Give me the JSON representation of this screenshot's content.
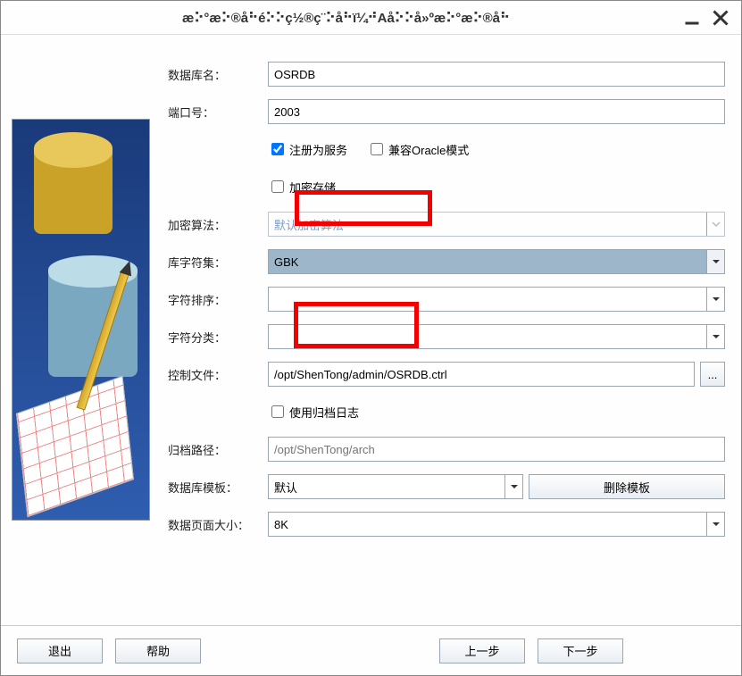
{
  "titlebar": {
    "title": "æ⠕°æ⠕®å⠓é⠕⠕ç½®ç¨⠕å⠓ï¼⠚Aå⠕⠕å»ºæ⠕°æ⠕®å⠓"
  },
  "labels": {
    "db_name": "数据库名：",
    "port": "端口号：",
    "reg_service": "注册为服务",
    "oracle_mode": "兼容Oracle模式",
    "encrypt_store": "加密存储",
    "encrypt_algo": "加密算法：",
    "charset": "库字符集：",
    "collation": "字符排序：",
    "char_class": "字符分类：",
    "ctrl_file": "控制文件：",
    "use_archive": "使用归档日志",
    "archive_path": "归档路径：",
    "db_template": "数据库模板：",
    "page_size": "数据页面大小："
  },
  "values": {
    "db_name": "OSRDB",
    "port": "2003",
    "reg_service_checked": true,
    "oracle_mode_checked": false,
    "encrypt_store_checked": false,
    "encrypt_algo": "默认加密算法",
    "charset": "GBK",
    "collation": "",
    "char_class": "",
    "ctrl_file": "/opt/ShenTong/admin/OSRDB.ctrl",
    "use_archive_checked": false,
    "archive_path_placeholder": "/opt/ShenTong/arch",
    "db_template": "默认",
    "page_size": "8K"
  },
  "buttons": {
    "browse": "...",
    "delete_template": "删除模板",
    "exit": "退出",
    "help": "帮助",
    "prev": "上一步",
    "next": "下一步"
  }
}
